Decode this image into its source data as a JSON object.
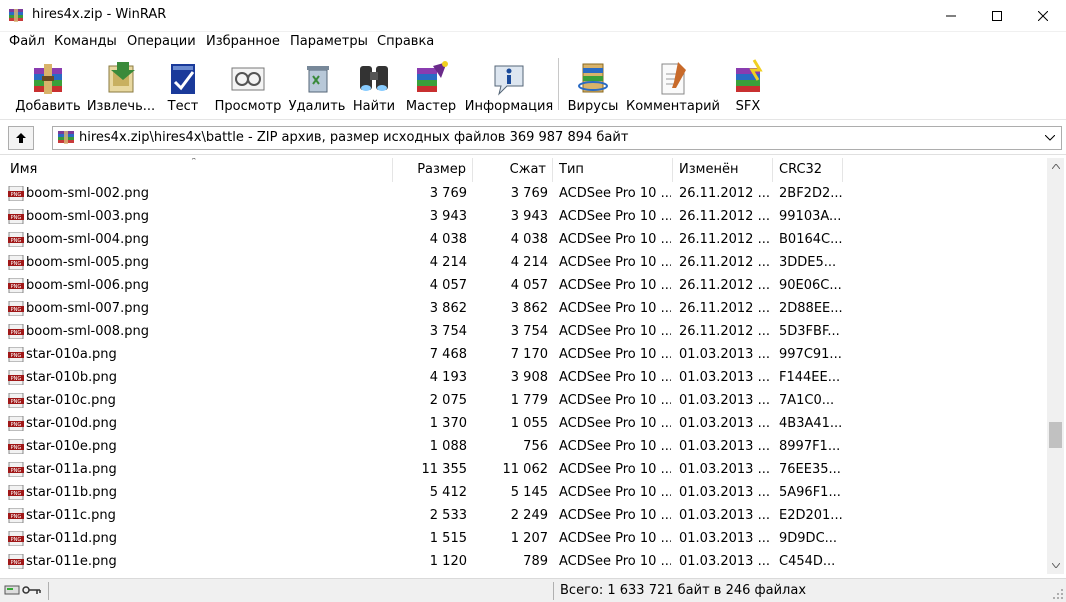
{
  "window": {
    "title": "hires4x.zip - WinRAR"
  },
  "menu": [
    "Файл",
    "Команды",
    "Операции",
    "Избранное",
    "Параметры",
    "Справка"
  ],
  "toolbar": [
    {
      "label": "Добавить",
      "icon": "add-archive-icon"
    },
    {
      "label": "Извлечь...",
      "icon": "extract-icon"
    },
    {
      "label": "Тест",
      "icon": "test-icon"
    },
    {
      "label": "Просмотр",
      "icon": "view-icon"
    },
    {
      "label": "Удалить",
      "icon": "delete-icon"
    },
    {
      "label": "Найти",
      "icon": "find-icon"
    },
    {
      "label": "Мастер",
      "icon": "wizard-icon"
    },
    {
      "label": "Информация",
      "icon": "info-icon"
    },
    {
      "label": "Вирусы",
      "icon": "virus-scan-icon"
    },
    {
      "label": "Комментарий",
      "icon": "comment-icon"
    },
    {
      "label": "SFX",
      "icon": "sfx-icon"
    }
  ],
  "address": {
    "path": "hires4x.zip\\hires4x\\battle - ZIP архив, размер исходных файлов 369 987 894 байт"
  },
  "columns": [
    "Имя",
    "Размер",
    "Сжат",
    "Тип",
    "Изменён",
    "CRC32"
  ],
  "files": [
    {
      "name": "boom-sml-002.png",
      "size": "3 769",
      "packed": "3 769",
      "type": "ACDSee Pro 10 ...",
      "modified": "26.11.2012 ...",
      "crc": "2BF2D2..."
    },
    {
      "name": "boom-sml-003.png",
      "size": "3 943",
      "packed": "3 943",
      "type": "ACDSee Pro 10 ...",
      "modified": "26.11.2012 ...",
      "crc": "99103A..."
    },
    {
      "name": "boom-sml-004.png",
      "size": "4 038",
      "packed": "4 038",
      "type": "ACDSee Pro 10 ...",
      "modified": "26.11.2012 ...",
      "crc": "B0164C..."
    },
    {
      "name": "boom-sml-005.png",
      "size": "4 214",
      "packed": "4 214",
      "type": "ACDSee Pro 10 ...",
      "modified": "26.11.2012 ...",
      "crc": "3DDE5..."
    },
    {
      "name": "boom-sml-006.png",
      "size": "4 057",
      "packed": "4 057",
      "type": "ACDSee Pro 10 ...",
      "modified": "26.11.2012 ...",
      "crc": "90E06C..."
    },
    {
      "name": "boom-sml-007.png",
      "size": "3 862",
      "packed": "3 862",
      "type": "ACDSee Pro 10 ...",
      "modified": "26.11.2012 ...",
      "crc": "2D88EE..."
    },
    {
      "name": "boom-sml-008.png",
      "size": "3 754",
      "packed": "3 754",
      "type": "ACDSee Pro 10 ...",
      "modified": "26.11.2012 ...",
      "crc": "5D3FBF..."
    },
    {
      "name": "star-010a.png",
      "size": "7 468",
      "packed": "7 170",
      "type": "ACDSee Pro 10 ...",
      "modified": "01.03.2013 ...",
      "crc": "997C91..."
    },
    {
      "name": "star-010b.png",
      "size": "4 193",
      "packed": "3 908",
      "type": "ACDSee Pro 10 ...",
      "modified": "01.03.2013 ...",
      "crc": "F144EE..."
    },
    {
      "name": "star-010c.png",
      "size": "2 075",
      "packed": "1 779",
      "type": "ACDSee Pro 10 ...",
      "modified": "01.03.2013 ...",
      "crc": "7A1C0..."
    },
    {
      "name": "star-010d.png",
      "size": "1 370",
      "packed": "1 055",
      "type": "ACDSee Pro 10 ...",
      "modified": "01.03.2013 ...",
      "crc": "4B3A41..."
    },
    {
      "name": "star-010e.png",
      "size": "1 088",
      "packed": "756",
      "type": "ACDSee Pro 10 ...",
      "modified": "01.03.2013 ...",
      "crc": "8997F1..."
    },
    {
      "name": "star-011a.png",
      "size": "11 355",
      "packed": "11 062",
      "type": "ACDSee Pro 10 ...",
      "modified": "01.03.2013 ...",
      "crc": "76EE35..."
    },
    {
      "name": "star-011b.png",
      "size": "5 412",
      "packed": "5 145",
      "type": "ACDSee Pro 10 ...",
      "modified": "01.03.2013 ...",
      "crc": "5A96F1..."
    },
    {
      "name": "star-011c.png",
      "size": "2 533",
      "packed": "2 249",
      "type": "ACDSee Pro 10 ...",
      "modified": "01.03.2013 ...",
      "crc": "E2D201..."
    },
    {
      "name": "star-011d.png",
      "size": "1 515",
      "packed": "1 207",
      "type": "ACDSee Pro 10 ...",
      "modified": "01.03.2013 ...",
      "crc": "9D9DC..."
    },
    {
      "name": "star-011e.png",
      "size": "1 120",
      "packed": "789",
      "type": "ACDSee Pro 10 ...",
      "modified": "01.03.2013 ...",
      "crc": "C454D..."
    }
  ],
  "status": {
    "summary": "Всего: 1 633 721 байт в 246 файлах"
  }
}
